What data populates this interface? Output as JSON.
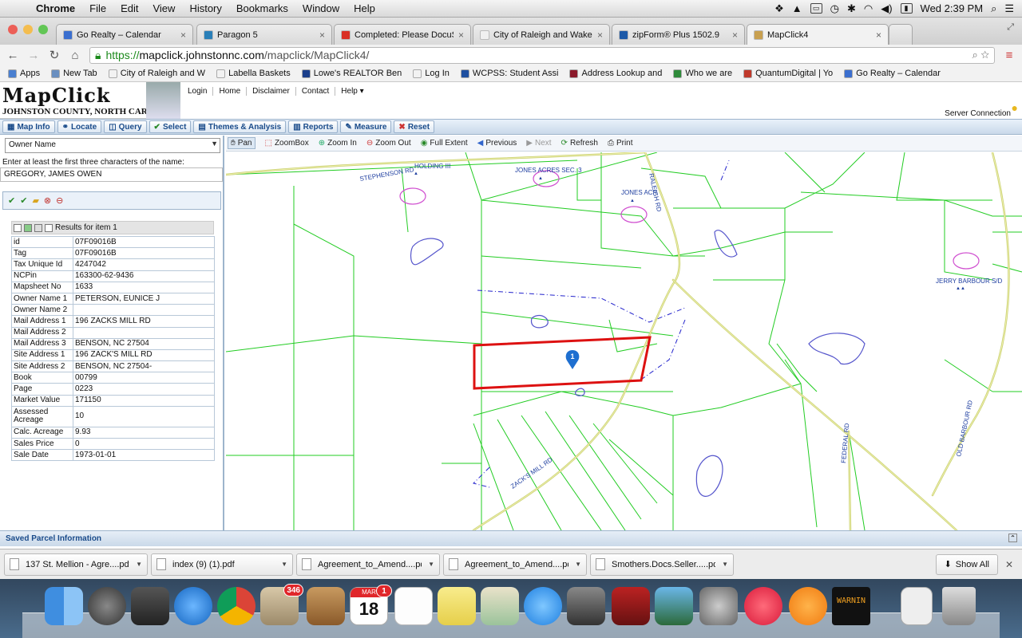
{
  "menubar": {
    "app": "Chrome",
    "items": [
      "File",
      "Edit",
      "View",
      "History",
      "Bookmarks",
      "Window",
      "Help"
    ],
    "clock": "Wed 2:39 PM"
  },
  "tabs": [
    {
      "title": "Go Realty – Calendar",
      "color": "#3b6fcf"
    },
    {
      "title": "Paragon 5",
      "color": "#2a7fb8"
    },
    {
      "title": "Completed: Please DocuSi",
      "color": "#d93025"
    },
    {
      "title": "City of Raleigh and Wake C",
      "color": "#f0f0f0"
    },
    {
      "title": "zipForm® Plus 1502.9",
      "color": "#1e5aa8"
    },
    {
      "title": "MapClick4",
      "color": "#c8a050"
    }
  ],
  "address": {
    "https": "https://",
    "domain": "mapclick.johnstonnc.com",
    "path": "/mapclick/MapClick4/"
  },
  "bookmarks": [
    {
      "label": "Apps",
      "color": "#4a7fd0"
    },
    {
      "label": "New Tab",
      "color": "#6a8fc0"
    },
    {
      "label": "City of Raleigh and W",
      "color": "#f2f2f2"
    },
    {
      "label": "Labella Baskets",
      "color": "#f2f2f2"
    },
    {
      "label": "Lowe's REALTOR Ben",
      "color": "#1b3f8b"
    },
    {
      "label": "Log In",
      "color": "#f2f2f2"
    },
    {
      "label": "WCPSS: Student Assi",
      "color": "#1e4fa0"
    },
    {
      "label": "Address Lookup and",
      "color": "#8b1a2b"
    },
    {
      "label": "Who we are",
      "color": "#2e8b3a"
    },
    {
      "label": "QuantumDigital | Yo",
      "color": "#c0392b"
    },
    {
      "label": "Go Realty – Calendar",
      "color": "#3b6fcf"
    }
  ],
  "mapclick": {
    "logo_title": "MapClick",
    "logo_sub": "JOHNSTON COUNTY, NORTH CAROLINA",
    "header_links": [
      "Login",
      "Home",
      "Disclaimer",
      "Contact",
      "Help ▾"
    ],
    "server_status": "Server Connection",
    "toolbar": [
      {
        "label": "Map Info",
        "icon": "info-icon"
      },
      {
        "label": "Locate",
        "icon": "binoculars-icon"
      },
      {
        "label": "Query",
        "icon": "query-icon"
      },
      {
        "label": "Select",
        "icon": "check-icon"
      },
      {
        "label": "Themes & Analysis",
        "icon": "layers-icon"
      },
      {
        "label": "Reports",
        "icon": "report-icon"
      },
      {
        "label": "Measure",
        "icon": "ruler-icon"
      },
      {
        "label": "Reset",
        "icon": "reset-icon"
      }
    ],
    "search_type": "Owner Name",
    "search_prompt": "Enter at least the first three characters of the name:",
    "search_value": "GREGORY, JAMES OWEN",
    "results_title": "Results for item 1",
    "attributes": [
      {
        "key": "id",
        "value": "07F09016B"
      },
      {
        "key": "Tag",
        "value": "07F09016B"
      },
      {
        "key": "Tax Unique Id",
        "value": "4247042"
      },
      {
        "key": "NCPin",
        "value": "163300-62-9436"
      },
      {
        "key": "Mapsheet No",
        "value": "1633"
      },
      {
        "key": "Owner Name 1",
        "value": "PETERSON, EUNICE J"
      },
      {
        "key": "Owner Name 2",
        "value": ""
      },
      {
        "key": "Mail Address 1",
        "value": "196 ZACKS MILL RD"
      },
      {
        "key": "Mail Address 2",
        "value": ""
      },
      {
        "key": "Mail Address 3",
        "value": "BENSON, NC 27504"
      },
      {
        "key": "Site Address 1",
        "value": "196 ZACK'S MILL RD"
      },
      {
        "key": "Site Address 2",
        "value": "BENSON, NC 27504-"
      },
      {
        "key": "Book",
        "value": "00799"
      },
      {
        "key": "Page",
        "value": "0223"
      },
      {
        "key": "Market Value",
        "value": "171150"
      },
      {
        "key": "Assessed Acreage",
        "value": "10"
      },
      {
        "key": "Calc. Acreage",
        "value": "9.93"
      },
      {
        "key": "Sales Price",
        "value": "0"
      },
      {
        "key": "Sale Date",
        "value": "1973-01-01"
      }
    ],
    "map_tools": [
      "Pan",
      "ZoomBox",
      "Zoom In",
      "Zoom Out",
      "Full Extent",
      "Previous",
      "Next",
      "Refresh",
      "Print"
    ],
    "map_labels": {
      "stephenson": "STEPHENSON RD",
      "holding": "HOLDING III",
      "jones_sec": "JONES ACRES SEC. 3",
      "jones": "JONES ACR",
      "raleigh": "RALEIGH RD",
      "jerry": "JERRY BARBOUR S/D",
      "zacks": "ZACK'S MILL RD",
      "federal": "FEDERAL RD",
      "old_barbour": "OLD BARBOUR RD",
      "marker": "1"
    },
    "saved_panel": "Saved Parcel Information"
  },
  "downloads": [
    "137 St. Mellion - Agre....pdf",
    "index (9) (1).pdf",
    "Agreement_to_Amend....pdf",
    "Agreement_to_Amend....pdf",
    "Smothers.Docs.Seller.....pdf"
  ],
  "show_all": "Show All",
  "dock": {
    "mail_badge": "346",
    "calendar_month": "MAR",
    "calendar_day": "18",
    "calendar_badge": "1",
    "console_text": "WARNIN"
  }
}
